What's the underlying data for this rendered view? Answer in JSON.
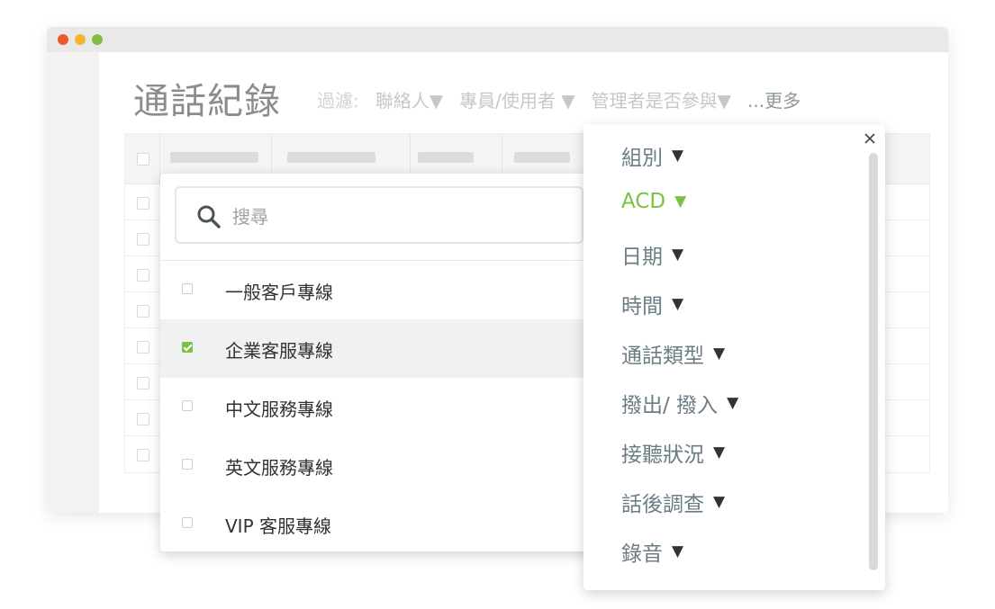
{
  "window": {
    "page_title": "通話紀錄",
    "filters": {
      "label": "過濾:",
      "items": [
        "聯絡人▼",
        "專員/使用者 ▼",
        "管理者是否參與▼"
      ],
      "more": "...更多"
    }
  },
  "list_panel": {
    "search_placeholder": "搜尋",
    "items": [
      {
        "label": "一般客戶專線",
        "checked": false
      },
      {
        "label": "企業客服專線",
        "checked": true
      },
      {
        "label": "中文服務專線",
        "checked": false
      },
      {
        "label": "英文服務專線",
        "checked": false
      },
      {
        "label": "VIP 客服專線",
        "checked": false
      }
    ]
  },
  "more_panel": {
    "items": [
      {
        "label": "組別",
        "caret": "▼"
      },
      {
        "label": "ACD",
        "caret": "▼",
        "active": true
      },
      {
        "label": "日期",
        "caret": "▼"
      },
      {
        "label": "時間",
        "caret": "▼"
      },
      {
        "label": "通話類型",
        "caret": "▼"
      },
      {
        "label": "撥出/ 撥入",
        "caret": "▼"
      },
      {
        "label": "接聽狀況",
        "caret": "▼"
      },
      {
        "label": "話後調查",
        "caret": "▼"
      },
      {
        "label": "錄音",
        "caret": "▼"
      }
    ]
  },
  "colors": {
    "accent": "#7dc142",
    "title_text": "#8c8c8c",
    "menu_text": "#6b7d84"
  }
}
